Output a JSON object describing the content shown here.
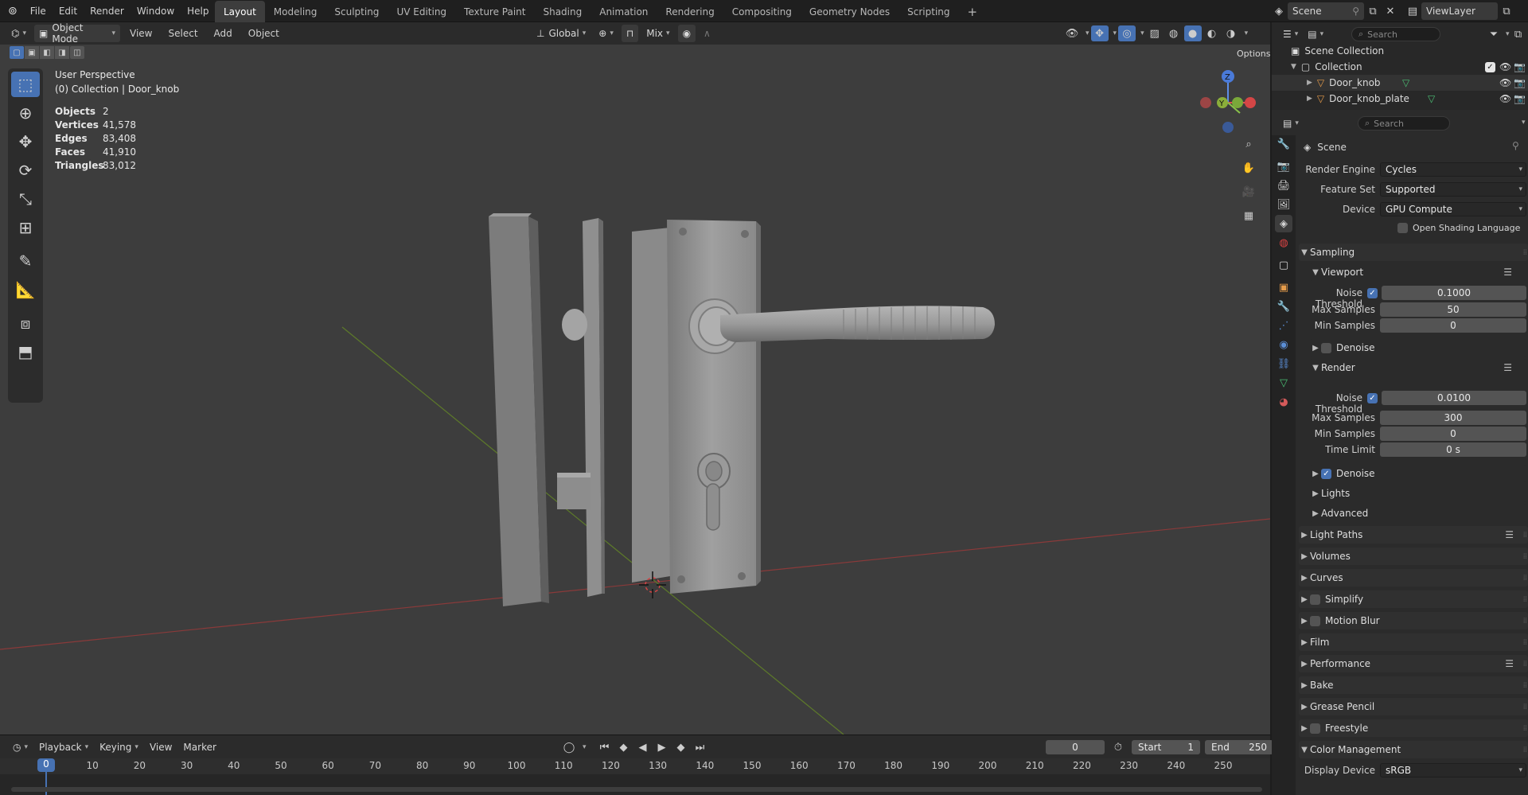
{
  "topbar": {
    "menus": [
      "File",
      "Edit",
      "Render",
      "Window",
      "Help"
    ],
    "workspaces": [
      "Layout",
      "Modeling",
      "Sculpting",
      "UV Editing",
      "Texture Paint",
      "Shading",
      "Animation",
      "Rendering",
      "Compositing",
      "Geometry Nodes",
      "Scripting"
    ],
    "active_workspace": "Layout",
    "add_workspace": "+",
    "scene_name": "Scene",
    "view_layer": "ViewLayer"
  },
  "viewport_header": {
    "mode": "Object Mode",
    "menus": [
      "View",
      "Select",
      "Add",
      "Object"
    ],
    "transform_orientation": "Global",
    "snap_mode": "Mix",
    "options_label": "Options"
  },
  "viewport_overlay": {
    "perspective": "User Perspective",
    "context": "(0) Collection | Door_knob",
    "stats": [
      {
        "label": "Objects",
        "value": "2"
      },
      {
        "label": "Vertices",
        "value": "41,578"
      },
      {
        "label": "Edges",
        "value": "83,408"
      },
      {
        "label": "Faces",
        "value": "41,910"
      },
      {
        "label": "Triangles",
        "value": "83,012"
      }
    ],
    "gizmo": {
      "z": "Z",
      "y": "Y"
    }
  },
  "timeline": {
    "menus": [
      "Playback",
      "Keying",
      "View",
      "Marker"
    ],
    "current_frame": "0",
    "start_label": "Start",
    "start": "1",
    "end_label": "End",
    "end": "250",
    "ticks": [
      "0",
      "10",
      "20",
      "30",
      "40",
      "50",
      "60",
      "70",
      "80",
      "90",
      "100",
      "110",
      "120",
      "130",
      "140",
      "150",
      "160",
      "170",
      "180",
      "190",
      "200",
      "210",
      "220",
      "230",
      "240",
      "250"
    ]
  },
  "outliner": {
    "search_placeholder": "Search",
    "items": [
      {
        "label": "Scene Collection"
      },
      {
        "label": "Collection"
      },
      {
        "label": "Door_knob"
      },
      {
        "label": "Door_knob_plate"
      }
    ]
  },
  "properties": {
    "search_placeholder": "Search",
    "context": "Scene",
    "render_engine_label": "Render Engine",
    "render_engine": "Cycles",
    "feature_set_label": "Feature Set",
    "feature_set": "Supported",
    "device_label": "Device",
    "device": "GPU Compute",
    "osl_label": "Open Shading Language",
    "sampling": "Sampling",
    "viewport": "Viewport",
    "vp_noise_label": "Noise Threshold",
    "vp_noise": "0.1000",
    "vp_max_label": "Max Samples",
    "vp_max": "50",
    "vp_min_label": "Min Samples",
    "vp_min": "0",
    "vp_denoise": "Denoise",
    "render": "Render",
    "r_noise_label": "Noise Threshold",
    "r_noise": "0.0100",
    "r_max_label": "Max Samples",
    "r_max": "300",
    "r_min_label": "Min Samples",
    "r_min": "0",
    "r_time_label": "Time Limit",
    "r_time": "0 s",
    "r_denoise": "Denoise",
    "lights": "Lights",
    "advanced": "Advanced",
    "panels": [
      "Light Paths",
      "Volumes",
      "Curves",
      "Simplify",
      "Motion Blur",
      "Film",
      "Performance",
      "Bake",
      "Grease Pencil",
      "Freestyle",
      "Color Management"
    ],
    "display_device_label": "Display Device",
    "display_device": "sRGB"
  }
}
